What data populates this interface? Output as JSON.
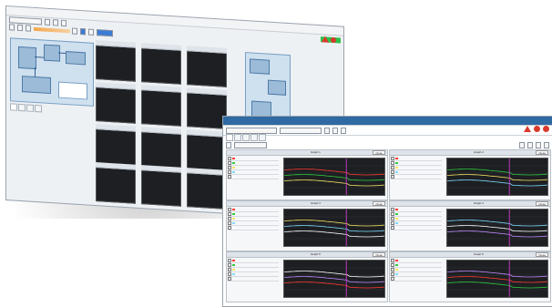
{
  "back_window": {
    "title": "",
    "toolbar_value": "",
    "status_label": "",
    "graph_titles": [
      "",
      "",
      "",
      "",
      "",
      "",
      "",
      "",
      "",
      "",
      "",
      ""
    ]
  },
  "front_window": {
    "title": "",
    "combo_value": "",
    "status_text": "",
    "graph_titles": [
      "Graph 1",
      "Graph 2",
      "Graph 3",
      "Graph 4",
      "Graph 5",
      "Graph 6"
    ],
    "close_labels": [
      "Close",
      "Close",
      "Close",
      "Close",
      "Close",
      "Close"
    ],
    "legend_rows": [
      {
        "name": "",
        "value": ""
      },
      {
        "name": "",
        "value": ""
      },
      {
        "name": "",
        "value": ""
      },
      {
        "name": "",
        "value": ""
      },
      {
        "name": "",
        "value": ""
      }
    ],
    "series_colors": [
      "#ff3b30",
      "#2ecc40",
      "#f5e663",
      "#7fdbff",
      "#ffffff",
      "#c28cff"
    ],
    "marker_color": "#d03cd0"
  },
  "accent": {
    "green": "#2fbf4a",
    "red": "#d83a2c",
    "blue": "#2f6aa3"
  }
}
